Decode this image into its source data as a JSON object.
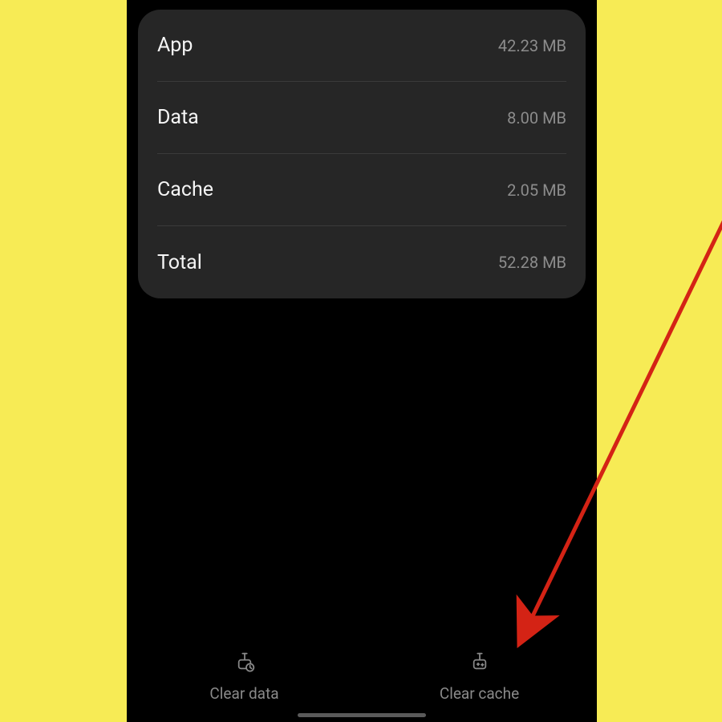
{
  "storage": {
    "rows": [
      {
        "label": "App",
        "value": "42.23 MB"
      },
      {
        "label": "Data",
        "value": "8.00 MB"
      },
      {
        "label": "Cache",
        "value": "2.05 MB"
      },
      {
        "label": "Total",
        "value": "52.28 MB"
      }
    ]
  },
  "actions": {
    "clear_data": "Clear data",
    "clear_cache": "Clear cache"
  },
  "annotation": {
    "arrow_color": "#d42315"
  }
}
